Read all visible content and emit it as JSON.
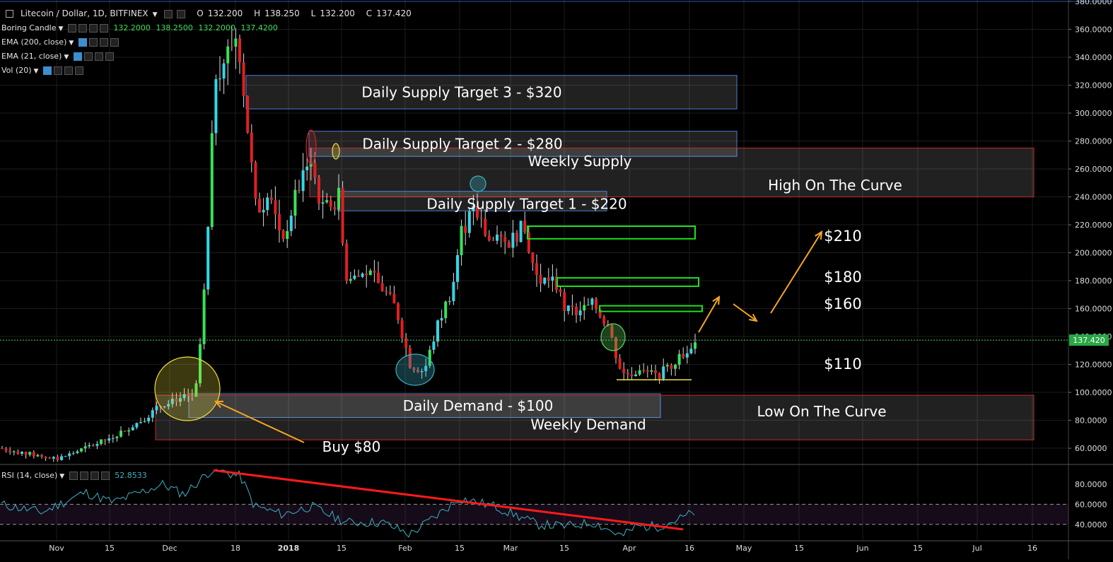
{
  "header": {
    "symbol": "Litecoin / Dollar, 1D, BITFINEX",
    "open_label": "O",
    "open": "132.200",
    "high_label": "H",
    "high": "138.250",
    "low_label": "L",
    "low": "132.200",
    "close_label": "C",
    "close": "137.420"
  },
  "indicators": [
    {
      "name": "Boring Candle",
      "values": [
        "132.2000",
        "138.2500",
        "132.2000",
        "137.4200"
      ]
    },
    {
      "name": "EMA (200, close)"
    },
    {
      "name": "EMA (21, close)"
    },
    {
      "name": "Vol (20)"
    }
  ],
  "rsi": {
    "name": "RSI (14, close)",
    "value": "52.8533"
  },
  "price_axis": {
    "ticks": [
      "380.0000",
      "360.0000",
      "340.0000",
      "320.0000",
      "300.0000",
      "280.0000",
      "260.0000",
      "240.0000",
      "220.0000",
      "200.0000",
      "180.0000",
      "160.0000",
      "140.0000",
      "120.0000",
      "100.0000",
      "80.0000",
      "60.0000"
    ],
    "last_price": "137.420",
    "last_price_value": 137.42,
    "min": 49.4,
    "max": 381.0
  },
  "rsi_axis": {
    "ticks": [
      "80.0000",
      "60.0000",
      "40.0000"
    ],
    "min": 25,
    "max": 97
  },
  "time_axis": {
    "labels": [
      "Nov",
      "15",
      "Dec",
      "18",
      "2018",
      "15",
      "Feb",
      "15",
      "Mar",
      "15",
      "Apr",
      "16",
      "May",
      "15",
      "Jun",
      "15",
      "Jul",
      "16"
    ]
  },
  "zones": [
    {
      "label": "Daily Supply Target 3 - $320",
      "low": 303,
      "high": 327,
      "border": "#4a7fd0"
    },
    {
      "label": "Daily Supply Target 2 - $280",
      "low": 269,
      "high": 287,
      "border": "#4a7fd0"
    },
    {
      "label": "Weekly Supply",
      "low": 240,
      "high": 275,
      "border": "#c62828"
    },
    {
      "label": "Daily Supply Target 1 - $220",
      "low": 230,
      "high": 244,
      "border": "#4a7fd0"
    },
    {
      "label": "Daily Demand - $100",
      "low": 82,
      "high": 99,
      "border": "#4a7fd0"
    },
    {
      "label": "Weekly Demand",
      "low": 66,
      "high": 98,
      "border": "#c62828"
    }
  ],
  "annotations": {
    "high_curve": "High On The Curve",
    "low_curve": "Low On The Curve",
    "buy": "Buy $80",
    "targets": [
      "$210",
      "$180",
      "$160",
      "$110"
    ]
  },
  "colors": {
    "up": "#37e15a",
    "down": "#e02020",
    "bg": "#000000",
    "grid": "#1c1c1c",
    "rsi": "#3bb3c3",
    "trend": "#ff1a1a",
    "arrow": "#f5a623"
  }
}
